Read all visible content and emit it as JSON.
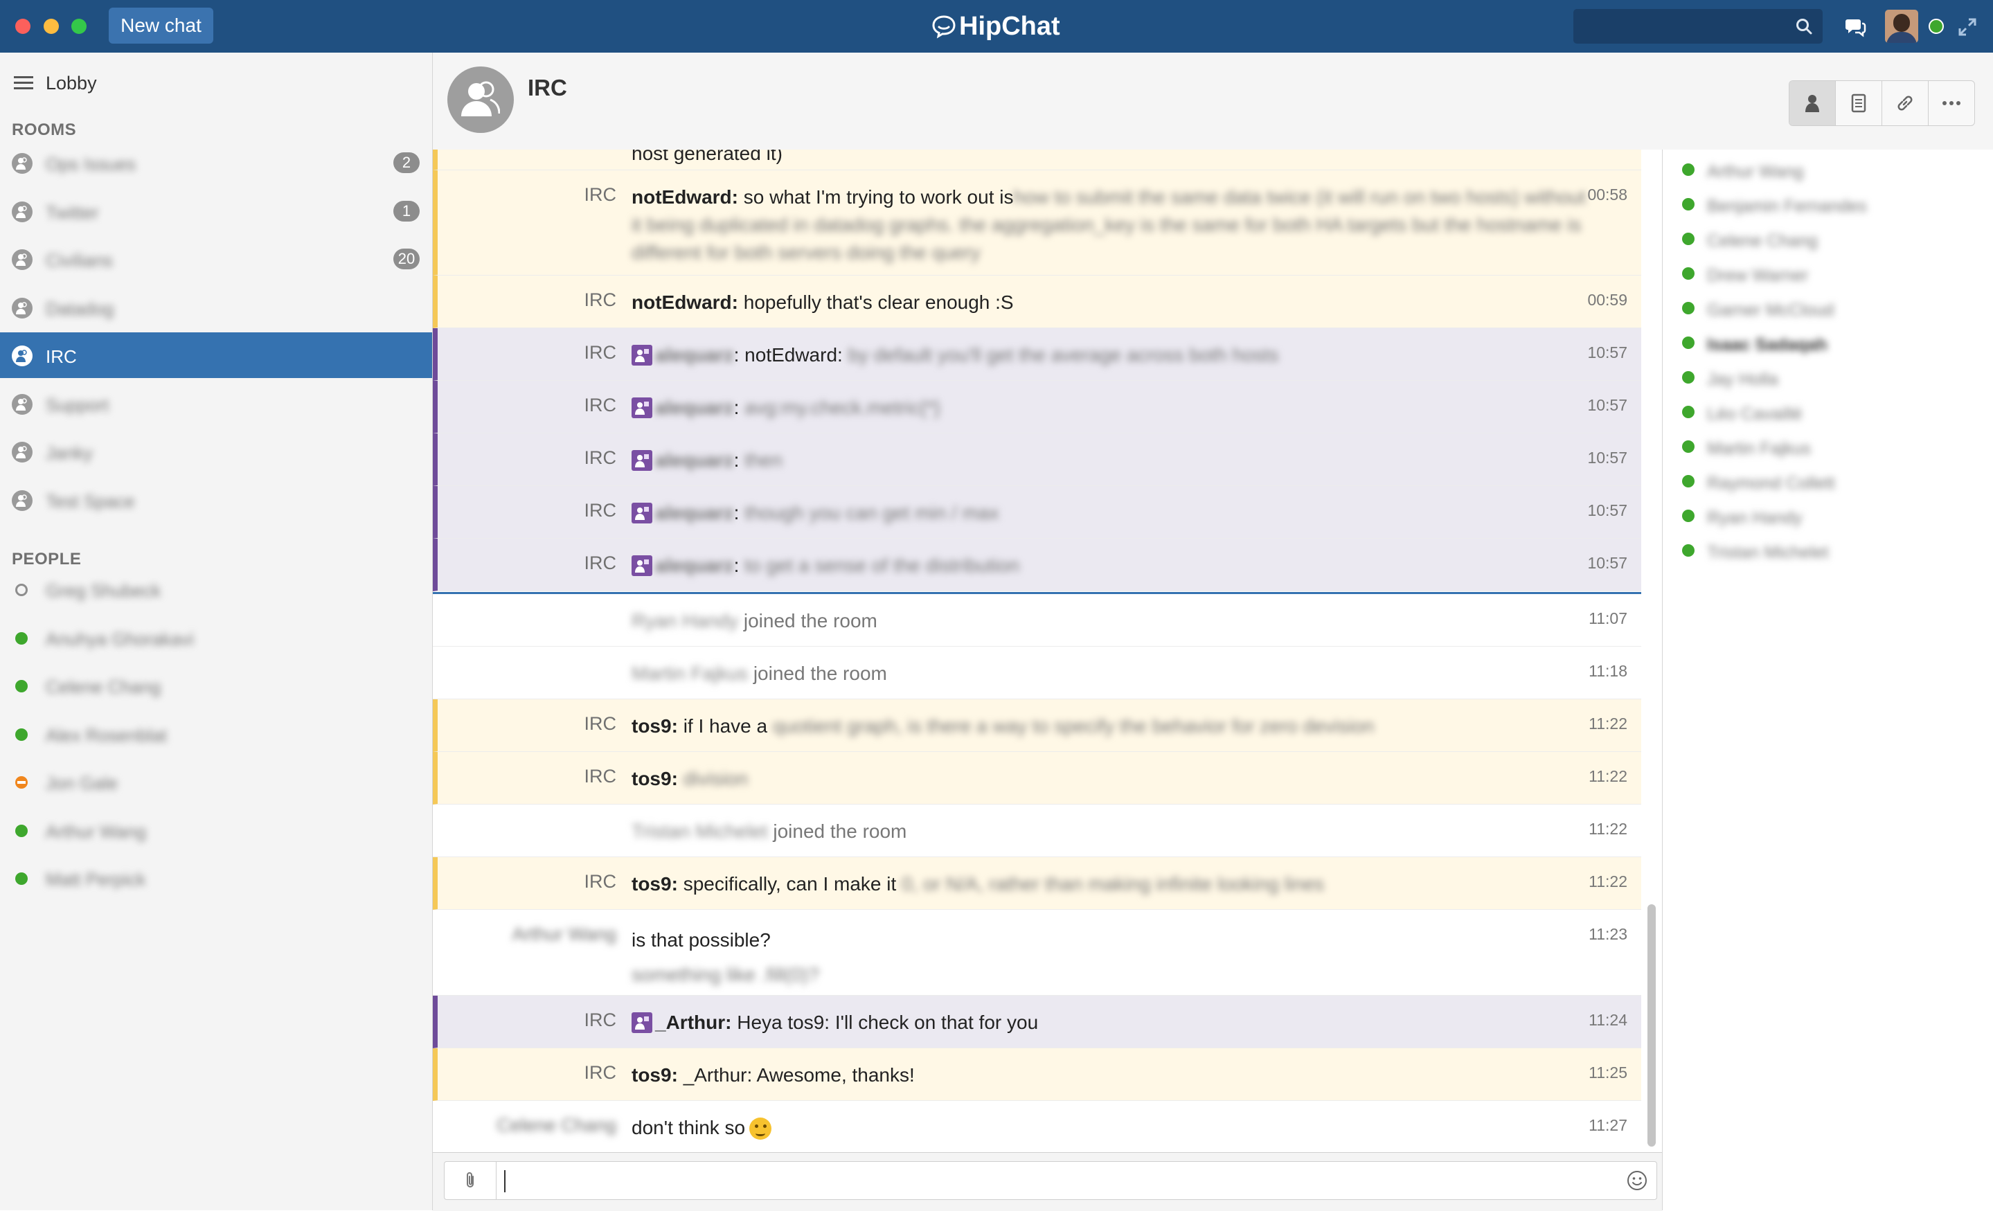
{
  "window": {
    "new_chat_label": "New chat",
    "app_name": "HipChat",
    "search_placeholder": ""
  },
  "sidebar": {
    "lobby_label": "Lobby",
    "rooms_heading": "ROOMS",
    "rooms": [
      {
        "name": "Ops Issues",
        "badge": "2"
      },
      {
        "name": "Twitter",
        "badge": "1"
      },
      {
        "name": "Civilians",
        "badge": "20"
      },
      {
        "name": "Datadog",
        "badge": ""
      },
      {
        "name": "IRC",
        "badge": ""
      },
      {
        "name": "Support",
        "badge": ""
      },
      {
        "name": "Janky",
        "badge": ""
      },
      {
        "name": "Test Space",
        "badge": ""
      }
    ],
    "people_heading": "PEOPLE",
    "people": [
      {
        "name": "Greg Shubeck",
        "status": "offline"
      },
      {
        "name": "Anuhya Ghorakavi",
        "status": "online"
      },
      {
        "name": "Celene Chang",
        "status": "online"
      },
      {
        "name": "Alex Rosenblat",
        "status": "online"
      },
      {
        "name": "Jon Gale",
        "status": "dnd"
      },
      {
        "name": "Arthur Wang",
        "status": "online"
      },
      {
        "name": "Matt Perpick",
        "status": "online"
      }
    ],
    "status_colors": {
      "online": "#3ea72d",
      "dnd": "#f0861d",
      "offline": "#8d8d8d"
    }
  },
  "room": {
    "title": "IRC"
  },
  "messages": [
    {
      "sender": "",
      "nick": "",
      "text": "host generated it)",
      "time": ""
    },
    {
      "sender": "IRC",
      "nick": "notEdward:",
      "text": "so what I'm trying to work out is",
      "blurred": "how to submit the same data twice (it will run on two hosts) without it being duplicated in datadog graphs. the aggregation_key is the same for both HA targets but the hostname is different for both servers doing the query",
      "time": "00:58"
    },
    {
      "sender": "IRC",
      "nick": "notEdward:",
      "text": "hopefully that's clear enough :S",
      "time": "00:59"
    },
    {
      "sender": "IRC",
      "nick": "alequarz",
      "text": ": notEdward:",
      "blurred": "by default you'll get the average across both hosts",
      "time": "10:57"
    },
    {
      "sender": "IRC",
      "nick": "alequarz",
      "text": ":",
      "blurred": "avg:my.check.metric{*}",
      "time": "10:57"
    },
    {
      "sender": "IRC",
      "nick": "alequarz",
      "text": ":",
      "blurred": "then",
      "time": "10:57"
    },
    {
      "sender": "IRC",
      "nick": "alequarz",
      "text": ":",
      "blurred": "though you can get min / max",
      "time": "10:57"
    },
    {
      "sender": "IRC",
      "nick": "alequarz",
      "text": ":",
      "blurred": "to get a sense of the distribution",
      "time": "10:57"
    },
    {
      "sender": "",
      "name": "Ryan Handy",
      "text": "joined the room",
      "time": "11:07"
    },
    {
      "sender": "",
      "name": "Martin Fajkus",
      "text": "joined the room",
      "time": "11:18"
    },
    {
      "sender": "IRC",
      "nick": "tos9:",
      "text": "if I have a",
      "blurred": "quotient graph, is there a way to specify the behavior for zero devision",
      "time": "11:22"
    },
    {
      "sender": "IRC",
      "nick": "tos9:",
      "text": "",
      "blurred": "division",
      "time": "11:22"
    },
    {
      "sender": "",
      "name": "Tristan Michelet",
      "text": "joined the room",
      "time": "11:22"
    },
    {
      "sender": "IRC",
      "nick": "tos9:",
      "text": "specifically, can I make it",
      "blurred": "0, or N/A, rather than making infinite looking lines",
      "time": "11:22"
    },
    {
      "sender": "Arthur Wang",
      "text": "is that possible?",
      "blurred": "something like .fill(0)?",
      "time": "11:23"
    },
    {
      "sender": "IRC",
      "nick": "_Arthur:",
      "text": "Heya tos9: I'll check on that for you",
      "time": "11:24"
    },
    {
      "sender": "IRC",
      "nick": "tos9:",
      "text": "_Arthur: Awesome, thanks!",
      "time": "11:25"
    },
    {
      "sender": "Celene Chang",
      "text": "don't think so",
      "time": "11:27"
    }
  ],
  "roster": [
    "Arthur Wang",
    "Benjamin Fernandes",
    "Celene Chang",
    "Drew Warner",
    "Garner McCloud",
    "Isaac Sadaqah",
    "Jay Holla",
    "Léo Cavaillé",
    "Martin Fajkus",
    "Raymond Collett",
    "Ryan Handy",
    "Tristan Michelet"
  ],
  "colors": {
    "titlebar": "#205081",
    "accent": "#3572b0",
    "irc_highlight": "#fff8e6",
    "irc_bar": "#f5c857",
    "bot_highlight": "#ebe9f1",
    "bot_bar": "#6e4b99"
  }
}
